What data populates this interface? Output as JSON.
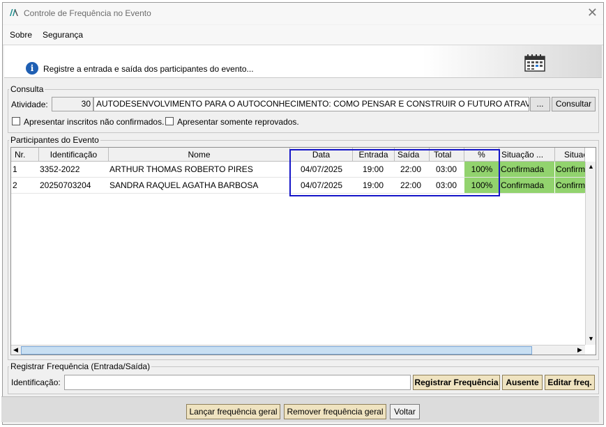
{
  "window": {
    "title": "Controle de Frequência no Evento"
  },
  "menu": {
    "items": [
      "Sobre",
      "Segurança"
    ]
  },
  "banner": {
    "text": "Registre a entrada e saída dos participantes do evento..."
  },
  "consulta": {
    "legend": "Consulta",
    "atividade_label": "Atividade:",
    "atividade_id": "30",
    "atividade_desc": "AUTODESENVOLVIMENTO PARA O AUTOCONHECIMENTO: COMO PENSAR E CONSTRUIR O FUTURO ATRAVÉS DE NOSSAS",
    "browse_label": "...",
    "consultar_label": "Consultar",
    "chk_nao_confirmados": "Apresentar inscritos não confirmados.",
    "chk_reprovados": "Apresentar somente reprovados."
  },
  "participantes": {
    "legend": "Participantes do Evento",
    "columns": [
      "Nr.",
      "Identificação",
      "Nome",
      "Data",
      "Entrada",
      "Saída",
      "Total",
      "%",
      "Situação ...",
      "Situaç"
    ],
    "rows": [
      {
        "nr": "1",
        "ident": "3352-2022",
        "nome": "ARTHUR THOMAS ROBERTO PIRES",
        "data": "04/07/2025",
        "entrada": "19:00",
        "saida": "22:00",
        "total": "03:00",
        "pct": "100%",
        "situacao1": "Confirmada",
        "situacao2": "Confirm"
      },
      {
        "nr": "2",
        "ident": "20250703204",
        "nome": "SANDRA RAQUEL AGATHA BARBOSA",
        "data": "04/07/2025",
        "entrada": "19:00",
        "saida": "22:00",
        "total": "03:00",
        "pct": "100%",
        "situacao1": "Confirmada",
        "situacao2": "Confirm"
      }
    ]
  },
  "registrar": {
    "legend": "Registrar Frequência (Entrada/Saída)",
    "ident_label": "Identificação:",
    "ident_value": "",
    "btn_registrar": "Registrar Frequência",
    "btn_ausente": "Ausente",
    "btn_editar": "Editar freq."
  },
  "footer": {
    "btn_lancar": "Lançar frequência geral",
    "btn_remover": "Remover frequência geral",
    "btn_voltar": "Voltar"
  },
  "colors": {
    "highlight": "#1414c8",
    "confirmed": "#92d36e",
    "button_tan": "#efe3c0",
    "info": "#1f5fb3"
  }
}
